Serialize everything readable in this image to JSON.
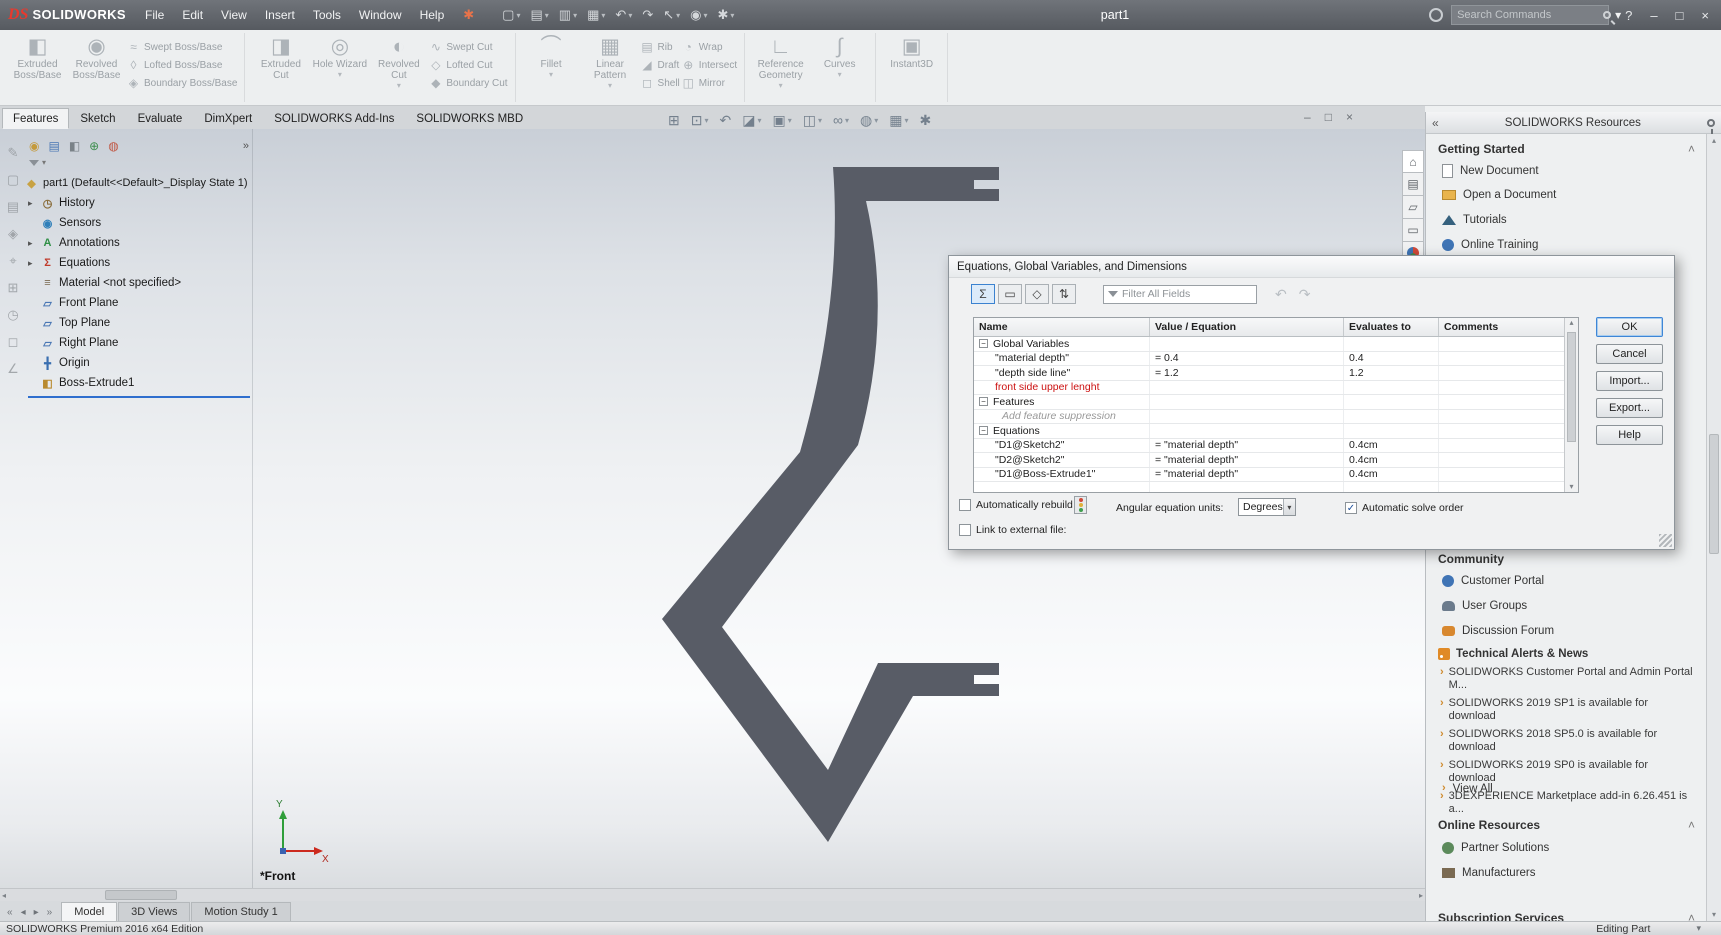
{
  "icons": {
    "caret": "▾",
    "chevron_up": "˄",
    "pane_collapse": "«",
    "pane_expand": "»",
    "expander": "▸",
    "minus": "−",
    "check": "✓",
    "close": "×",
    "minimize": "–",
    "restore": "□",
    "help": "?",
    "scroll_up": "▴",
    "scroll_down": "▾",
    "scroll_left": "◂",
    "scroll_right": "▸",
    "undo": "↶",
    "redo": "↷",
    "bullet": "›",
    "star": "✱"
  },
  "titlebar": {
    "logo_ds": "DS",
    "logo_text": "SOLIDWORKS",
    "menus": [
      "File",
      "Edit",
      "View",
      "Insert",
      "Tools",
      "Window",
      "Help"
    ],
    "tools": [
      {
        "g": "▢"
      },
      {
        "g": "▤"
      },
      {
        "g": "▥"
      },
      {
        "g": "▦"
      },
      {
        "g": "↶"
      },
      {
        "g": "↷"
      },
      {
        "g": "↖"
      },
      {
        "g": "◉"
      },
      {
        "g": "✱"
      }
    ],
    "document_title": "part1",
    "search_placeholder": "Search Commands"
  },
  "ribbon": {
    "groups": [
      {
        "large": [
          {
            "label": "Extruded Boss/Base",
            "icon": "◧"
          },
          {
            "label": "Revolved Boss/Base",
            "icon": "◉"
          }
        ],
        "small": [
          {
            "label": "Swept Boss/Base",
            "icon": "≈"
          },
          {
            "label": "Lofted Boss/Base",
            "icon": "◊"
          },
          {
            "label": "Boundary Boss/Base",
            "icon": "◈"
          }
        ]
      },
      {
        "large": [
          {
            "label": "Extruded Cut",
            "icon": "◨"
          },
          {
            "label": "Hole Wizard",
            "icon": "◎"
          },
          {
            "label": "Revolved Cut",
            "icon": "◐"
          }
        ],
        "small": [
          {
            "label": "Swept Cut",
            "icon": "∿"
          },
          {
            "label": "Lofted Cut",
            "icon": "◇"
          },
          {
            "label": "Boundary Cut",
            "icon": "◆"
          }
        ]
      },
      {
        "large": [
          {
            "label": "Fillet",
            "icon": "⌒"
          },
          {
            "label": "Linear Pattern",
            "icon": "▦"
          }
        ],
        "small": [
          {
            "label": "Rib",
            "icon": "▤"
          },
          {
            "label": "Draft",
            "icon": "◢"
          },
          {
            "label": "Shell",
            "icon": "◻"
          },
          {
            "label": "Wrap",
            "icon": "◔"
          },
          {
            "label": "Intersect",
            "icon": "⊕"
          },
          {
            "label": "Mirror",
            "icon": "◫"
          }
        ]
      },
      {
        "large": [
          {
            "label": "Reference Geometry",
            "icon": "∟"
          },
          {
            "label": "Curves",
            "icon": "∫"
          }
        ],
        "small": []
      },
      {
        "large": [
          {
            "label": "Instant3D",
            "icon": "▣"
          }
        ],
        "small": []
      }
    ]
  },
  "ribbon_tabs": [
    "Features",
    "Sketch",
    "Evaluate",
    "DimXpert",
    "SOLIDWORKS Add-Ins",
    "SOLIDWORKS MBD"
  ],
  "hud": {
    "icons": [
      {
        "g": "⊞"
      },
      {
        "g": "⊡"
      },
      {
        "g": "↶"
      },
      {
        "g": "◪"
      },
      {
        "g": "▣"
      },
      {
        "g": "◫"
      },
      {
        "g": "∞"
      },
      {
        "g": "◍"
      },
      {
        "g": "▦"
      },
      {
        "g": "✱"
      }
    ]
  },
  "left_toolbar": {
    "icons": [
      "✎",
      "▢",
      "▤",
      "◈",
      "⌖",
      "⊞",
      "◷",
      "◻",
      "∠"
    ]
  },
  "feature_tree": {
    "tabs": [
      {
        "g": "◉"
      },
      {
        "g": "▤"
      },
      {
        "g": "◧"
      },
      {
        "g": "⊕"
      },
      {
        "g": "◍"
      }
    ],
    "root_label": "part1 (Default<<Default>_Display State 1)",
    "items": [
      {
        "label": "History",
        "icon": "◷"
      },
      {
        "label": "Sensors",
        "icon": "◉"
      },
      {
        "label": "Annotations",
        "icon": "A"
      },
      {
        "label": "Equations",
        "icon": "Σ"
      },
      {
        "label": "Material <not specified>",
        "icon": "≡"
      },
      {
        "label": "Front Plane",
        "icon": "▱"
      },
      {
        "label": "Top Plane",
        "icon": "▱"
      },
      {
        "label": "Right Plane",
        "icon": "▱"
      },
      {
        "label": "Origin",
        "icon": "╋"
      },
      {
        "label": "Boss-Extrude1",
        "icon": "◧"
      }
    ]
  },
  "viewport": {
    "orientation_label": "*Front",
    "axis_x": "X",
    "axis_y": "Y"
  },
  "dialog": {
    "title": "Equations, Global Variables, and Dimensions",
    "toolbar": [
      {
        "g": "Σ"
      },
      {
        "g": "▭"
      },
      {
        "g": "◇"
      },
      {
        "g": "⇅"
      }
    ],
    "filter_placeholder": "Filter All Fields",
    "columns": [
      "Name",
      "Value / Equation",
      "Evaluates to",
      "Comments"
    ],
    "rows": [
      {
        "type": "group",
        "name": "Global Variables",
        "value": "",
        "evaluates": "",
        "comment": ""
      },
      {
        "type": "data",
        "name": "\"material depth\"",
        "value": "= 0.4",
        "evaluates": "0.4",
        "comment": ""
      },
      {
        "type": "data",
        "name": "\"depth side line\"",
        "value": "= 1.2",
        "evaluates": "1.2",
        "comment": ""
      },
      {
        "type": "entry",
        "name": "front side upper lenght",
        "value": "",
        "evaluates": "",
        "comment": ""
      },
      {
        "type": "group",
        "name": "Features",
        "value": "",
        "evaluates": "",
        "comment": ""
      },
      {
        "type": "hint",
        "name": "Add feature suppression",
        "value": "",
        "evaluates": "",
        "comment": ""
      },
      {
        "type": "group",
        "name": "Equations",
        "value": "",
        "evaluates": "",
        "comment": ""
      },
      {
        "type": "data",
        "name": "\"D1@Sketch2\"",
        "value": "= \"material depth\"",
        "evaluates": "0.4cm",
        "comment": ""
      },
      {
        "type": "data",
        "name": "\"D2@Sketch2\"",
        "value": "= \"material depth\"",
        "evaluates": "0.4cm",
        "comment": ""
      },
      {
        "type": "data",
        "name": "\"D1@Boss-Extrude1\"",
        "value": "= \"material depth\"",
        "evaluates": "0.4cm",
        "comment": ""
      }
    ],
    "buttons": [
      "OK",
      "Cancel",
      "Import...",
      "Export...",
      "Help"
    ],
    "auto_rebuild_label": "Automatically rebuild",
    "angular_units_label": "Angular equation units:",
    "angular_units_value": "Degrees",
    "auto_solve_label": "Automatic solve order",
    "link_external_label": "Link to external file:"
  },
  "task_pane": {
    "title": "SOLIDWORKS Resources",
    "tabs": [
      {
        "g": "⌂"
      },
      {
        "g": "▤"
      },
      {
        "g": "▱"
      },
      {
        "g": "▭"
      }
    ],
    "getting_started": {
      "title": "Getting Started",
      "items": [
        "New Document",
        "Open a Document",
        "Tutorials",
        "Online Training"
      ]
    },
    "community": {
      "title": "Community",
      "items": [
        "Customer Portal",
        "User Groups",
        "Discussion Forum"
      ]
    },
    "alerts": {
      "title": "Technical Alerts & News",
      "items": [
        "SOLIDWORKS Customer Portal and Admin Portal M...",
        "SOLIDWORKS 2019 SP1 is available for download",
        "SOLIDWORKS 2018 SP5.0 is available for download",
        "SOLIDWORKS 2019 SP0 is available for download",
        "3DEXPERIENCE Marketplace add-in 6.26.451 is a..."
      ],
      "view_all": "View All"
    },
    "online_resources": {
      "title": "Online Resources",
      "items": [
        "Partner Solutions",
        "Manufacturers"
      ]
    },
    "subscription": {
      "title": "Subscription Services"
    }
  },
  "bottom_bar": {
    "tabs": [
      "Model",
      "3D Views",
      "Motion Study 1"
    ]
  },
  "status_bar": {
    "left": "SOLIDWORKS Premium 2016 x64 Edition",
    "editing": "Editing Part"
  }
}
